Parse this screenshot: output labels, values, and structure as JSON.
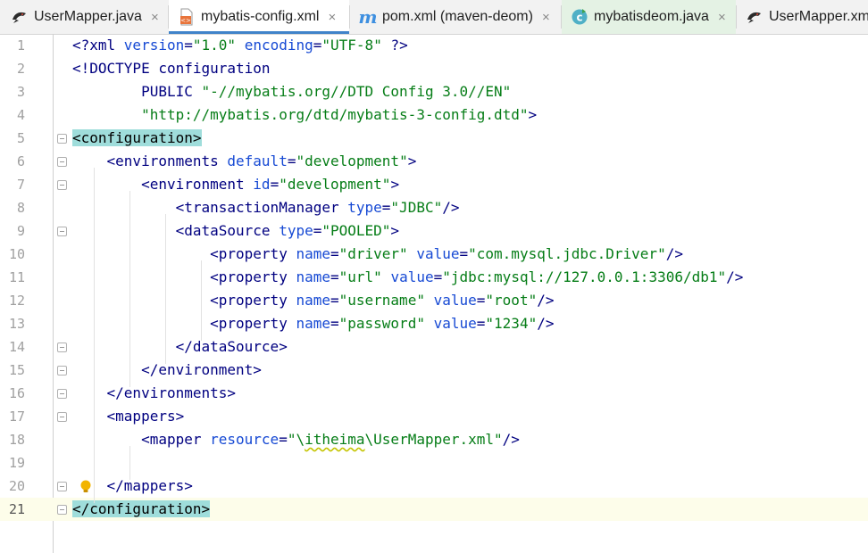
{
  "tabs": [
    {
      "label": "UserMapper.java",
      "icon": "bird-icon",
      "close": "×",
      "state": "normal"
    },
    {
      "label": "mybatis-config.xml",
      "icon": "xml-file-icon",
      "close": "×",
      "state": "active"
    },
    {
      "label": "pom.xml (maven-deom)",
      "icon": "maven-icon",
      "close": "×",
      "state": "normal"
    },
    {
      "label": "mybatisdeom.java",
      "icon": "java-class-icon",
      "close": "×",
      "state": "tinted"
    },
    {
      "label": "UserMapper.xm",
      "icon": "bird-icon",
      "close": "",
      "state": "normal"
    }
  ],
  "colors": {
    "tag": "#000080",
    "attr": "#174ad4",
    "string": "#067d17",
    "match_highlight": "#9fdddb",
    "active_tab_underline": "#4083c9"
  },
  "editor": {
    "current_line": 21,
    "lines": [
      {
        "num": "1",
        "segs": [
          [
            "pi",
            "<?xml "
          ],
          [
            "attr",
            "version"
          ],
          [
            "pi",
            "="
          ],
          [
            "str",
            "\"1.0\""
          ],
          [
            "pi",
            " "
          ],
          [
            "attr",
            "encoding"
          ],
          [
            "pi",
            "="
          ],
          [
            "str",
            "\"UTF-8\""
          ],
          [
            "pi",
            " ?>"
          ]
        ]
      },
      {
        "num": "2",
        "segs": [
          [
            "tag",
            "<!DOCTYPE configuration"
          ]
        ]
      },
      {
        "num": "3",
        "segs": [
          [
            "tag",
            "        PUBLIC "
          ],
          [
            "str",
            "\"-//mybatis.org//DTD Config 3.0//EN\""
          ]
        ]
      },
      {
        "num": "4",
        "segs": [
          [
            "str",
            "        \"http://mybatis.org/dtd/mybatis-3-config.dtd\""
          ],
          [
            "tag",
            ">"
          ]
        ]
      },
      {
        "num": "5",
        "segs": [
          [
            "match",
            "<configuration>"
          ]
        ]
      },
      {
        "num": "6",
        "segs": [
          [
            "tag",
            "    <environments "
          ],
          [
            "attr",
            "default"
          ],
          [
            "tag",
            "="
          ],
          [
            "str",
            "\"development\""
          ],
          [
            "tag",
            ">"
          ]
        ]
      },
      {
        "num": "7",
        "segs": [
          [
            "tag",
            "        <environment "
          ],
          [
            "attr",
            "id"
          ],
          [
            "tag",
            "="
          ],
          [
            "str",
            "\"development\""
          ],
          [
            "tag",
            ">"
          ]
        ]
      },
      {
        "num": "8",
        "segs": [
          [
            "tag",
            "            <transactionManager "
          ],
          [
            "attr",
            "type"
          ],
          [
            "tag",
            "="
          ],
          [
            "str",
            "\"JDBC\""
          ],
          [
            "tag",
            "/>"
          ]
        ]
      },
      {
        "num": "9",
        "segs": [
          [
            "tag",
            "            <dataSource "
          ],
          [
            "attr",
            "type"
          ],
          [
            "tag",
            "="
          ],
          [
            "str",
            "\"POOLED\""
          ],
          [
            "tag",
            ">"
          ]
        ]
      },
      {
        "num": "10",
        "segs": [
          [
            "tag",
            "                <property "
          ],
          [
            "attr",
            "name"
          ],
          [
            "tag",
            "="
          ],
          [
            "str",
            "\"driver\""
          ],
          [
            "tag",
            " "
          ],
          [
            "attr",
            "value"
          ],
          [
            "tag",
            "="
          ],
          [
            "str",
            "\"com.mysql.jdbc.Driver\""
          ],
          [
            "tag",
            "/>"
          ]
        ]
      },
      {
        "num": "11",
        "segs": [
          [
            "tag",
            "                <property "
          ],
          [
            "attr",
            "name"
          ],
          [
            "tag",
            "="
          ],
          [
            "str",
            "\"url\""
          ],
          [
            "tag",
            " "
          ],
          [
            "attr",
            "value"
          ],
          [
            "tag",
            "="
          ],
          [
            "str",
            "\"jdbc:mysql://127.0.0.1:3306/db1\""
          ],
          [
            "tag",
            "/>"
          ]
        ]
      },
      {
        "num": "12",
        "segs": [
          [
            "tag",
            "                <property "
          ],
          [
            "attr",
            "name"
          ],
          [
            "tag",
            "="
          ],
          [
            "str",
            "\"username\""
          ],
          [
            "tag",
            " "
          ],
          [
            "attr",
            "value"
          ],
          [
            "tag",
            "="
          ],
          [
            "str",
            "\"root\""
          ],
          [
            "tag",
            "/>"
          ]
        ]
      },
      {
        "num": "13",
        "segs": [
          [
            "tag",
            "                <property "
          ],
          [
            "attr",
            "name"
          ],
          [
            "tag",
            "="
          ],
          [
            "str",
            "\"password\""
          ],
          [
            "tag",
            " "
          ],
          [
            "attr",
            "value"
          ],
          [
            "tag",
            "="
          ],
          [
            "str",
            "\"1234\""
          ],
          [
            "tag",
            "/>"
          ]
        ]
      },
      {
        "num": "14",
        "segs": [
          [
            "tag",
            "            </dataSource>"
          ]
        ]
      },
      {
        "num": "15",
        "segs": [
          [
            "tag",
            "        </environment>"
          ]
        ]
      },
      {
        "num": "16",
        "segs": [
          [
            "tag",
            "    </environments>"
          ]
        ]
      },
      {
        "num": "17",
        "segs": [
          [
            "tag",
            "    <mappers>"
          ]
        ]
      },
      {
        "num": "18",
        "segs": [
          [
            "tag",
            "        <mapper "
          ],
          [
            "attr",
            "resource"
          ],
          [
            "tag",
            "="
          ],
          [
            "str",
            "\"\\"
          ],
          [
            "warn",
            "itheima"
          ],
          [
            "str",
            "\\UserMapper.xml\""
          ],
          [
            "tag",
            "/>"
          ]
        ]
      },
      {
        "num": "19",
        "segs": []
      },
      {
        "num": "20",
        "segs": [
          [
            "tag",
            "    </mappers>"
          ]
        ]
      },
      {
        "num": "21",
        "segs": [
          [
            "match",
            "</configuration>"
          ]
        ]
      }
    ]
  }
}
